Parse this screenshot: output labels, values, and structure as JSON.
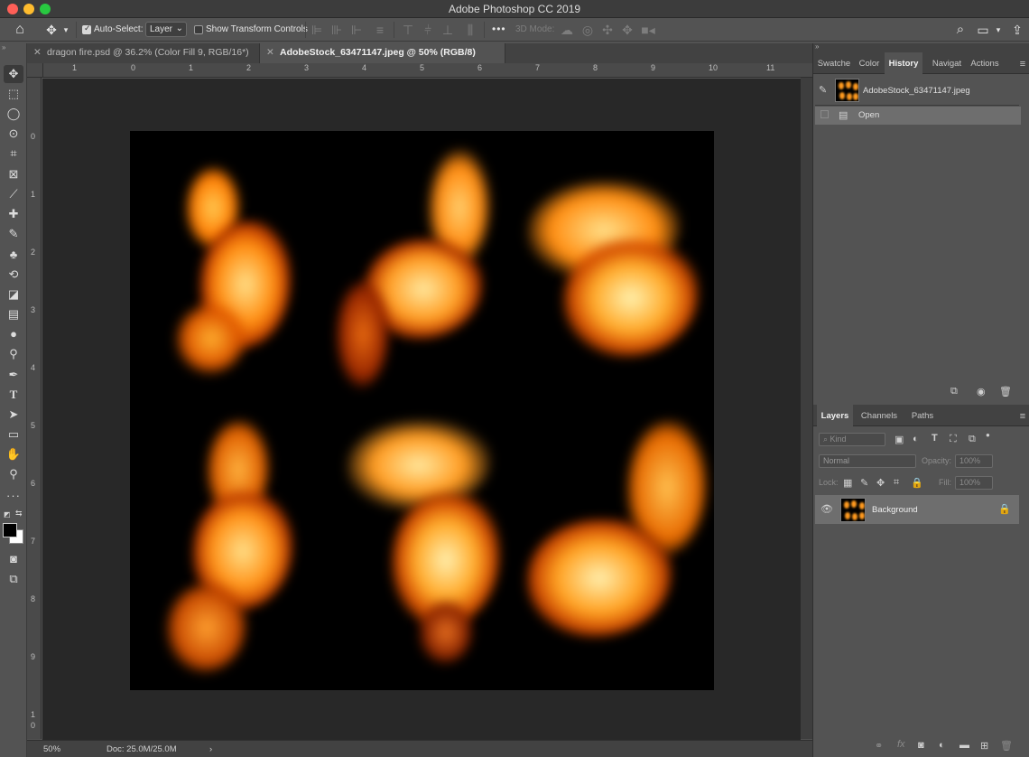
{
  "window": {
    "title": "Adobe Photoshop CC 2019",
    "traffic_colors": [
      "#fe5f57",
      "#febc2e",
      "#28c840"
    ]
  },
  "options_bar": {
    "auto_select_label": "Auto-Select:",
    "auto_select_checked": true,
    "auto_select_value": "Layer",
    "show_transform_label": "Show Transform Controls",
    "show_transform_checked": false,
    "more_label": "•••",
    "mode_3d_label": "3D Mode:"
  },
  "tabs": [
    {
      "label": "dragon fire.psd @ 36.2% (Color Fill 9, RGB/16*)",
      "active": false
    },
    {
      "label": "AdobeStock_63471147.jpeg @ 50% (RGB/8)",
      "active": true
    }
  ],
  "ruler": {
    "h_ticks": [
      "1",
      "0",
      "1",
      "2",
      "3",
      "4",
      "5",
      "6",
      "7",
      "8",
      "9",
      "10",
      "11"
    ],
    "v_ticks": [
      "0",
      "1",
      "2",
      "3",
      "4",
      "5",
      "6",
      "7",
      "8",
      "9",
      "1",
      "0"
    ]
  },
  "status_bar": {
    "zoom": "50%",
    "doc_info": "Doc: 25.0M/25.0M",
    "arrow": "›"
  },
  "history_panel": {
    "tabs": [
      "Swatche",
      "Color",
      "History",
      "Navigat",
      "Actions"
    ],
    "active_tab": "History",
    "snapshot_name": "AdobeStock_63471147.jpeg",
    "states": [
      "Open"
    ]
  },
  "layers_panel": {
    "tabs": [
      "Layers",
      "Channels",
      "Paths"
    ],
    "active_tab": "Layers",
    "kind_placeholder": "Kind",
    "blend_mode": "Normal",
    "opacity_label": "Opacity:",
    "opacity_value": "100%",
    "lock_label": "Lock:",
    "fill_label": "Fill:",
    "fill_value": "100%",
    "layers": [
      {
        "name": "Background",
        "visible": true,
        "locked": true
      }
    ],
    "footer_icons": [
      "link-icon",
      "fx-icon",
      "mask-icon",
      "adjustment-icon",
      "group-icon",
      "new-layer-icon",
      "trash-icon"
    ]
  },
  "colors": {
    "foreground": "#000000",
    "background": "#ffffff",
    "accent_flame": "#ff8a00"
  }
}
